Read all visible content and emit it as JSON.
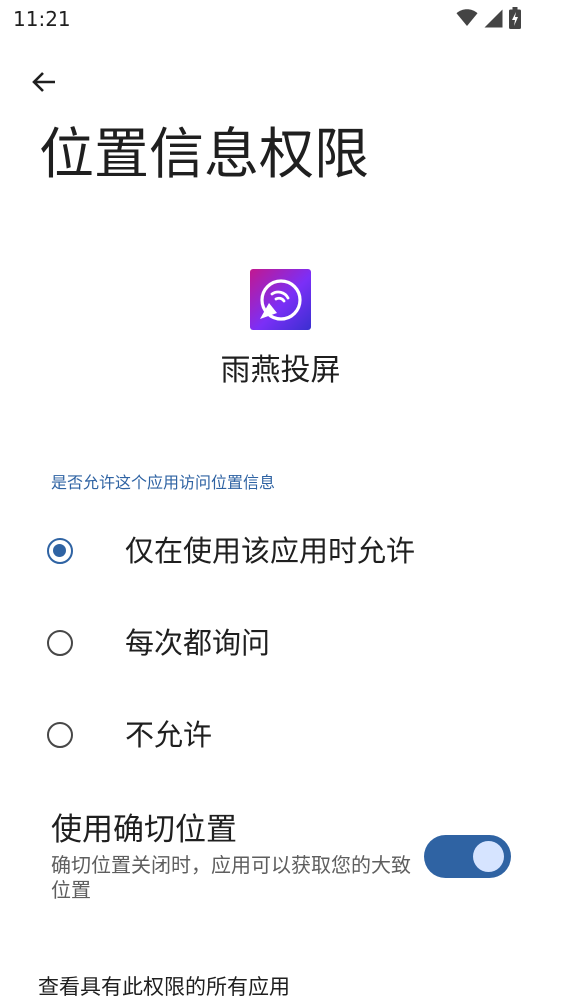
{
  "status_bar": {
    "time": "11:21",
    "icons": [
      "wifi-icon",
      "cellular-signal-icon",
      "battery-charging-icon"
    ]
  },
  "header": {
    "back_icon": "arrow-left-icon",
    "title": "位置信息权限"
  },
  "app": {
    "name": "雨燕投屏",
    "icon_colors": [
      "#c2188f",
      "#7b2ff7",
      "#3a2fd0"
    ]
  },
  "permission": {
    "question": "是否允许这个应用访问位置信息",
    "options": [
      {
        "label": "仅在使用该应用时允许",
        "selected": true
      },
      {
        "label": "每次都询问",
        "selected": false
      },
      {
        "label": "不允许",
        "selected": false
      }
    ]
  },
  "precise_location": {
    "title": "使用确切位置",
    "description": "确切位置关闭时，应用可以获取您的大致位置",
    "enabled": true
  },
  "footer": {
    "link": "查看具有此权限的所有应用"
  },
  "colors": {
    "accent": "#2f63a3",
    "text": "#1f1f1f",
    "secondary_text": "#5e5e5e"
  }
}
